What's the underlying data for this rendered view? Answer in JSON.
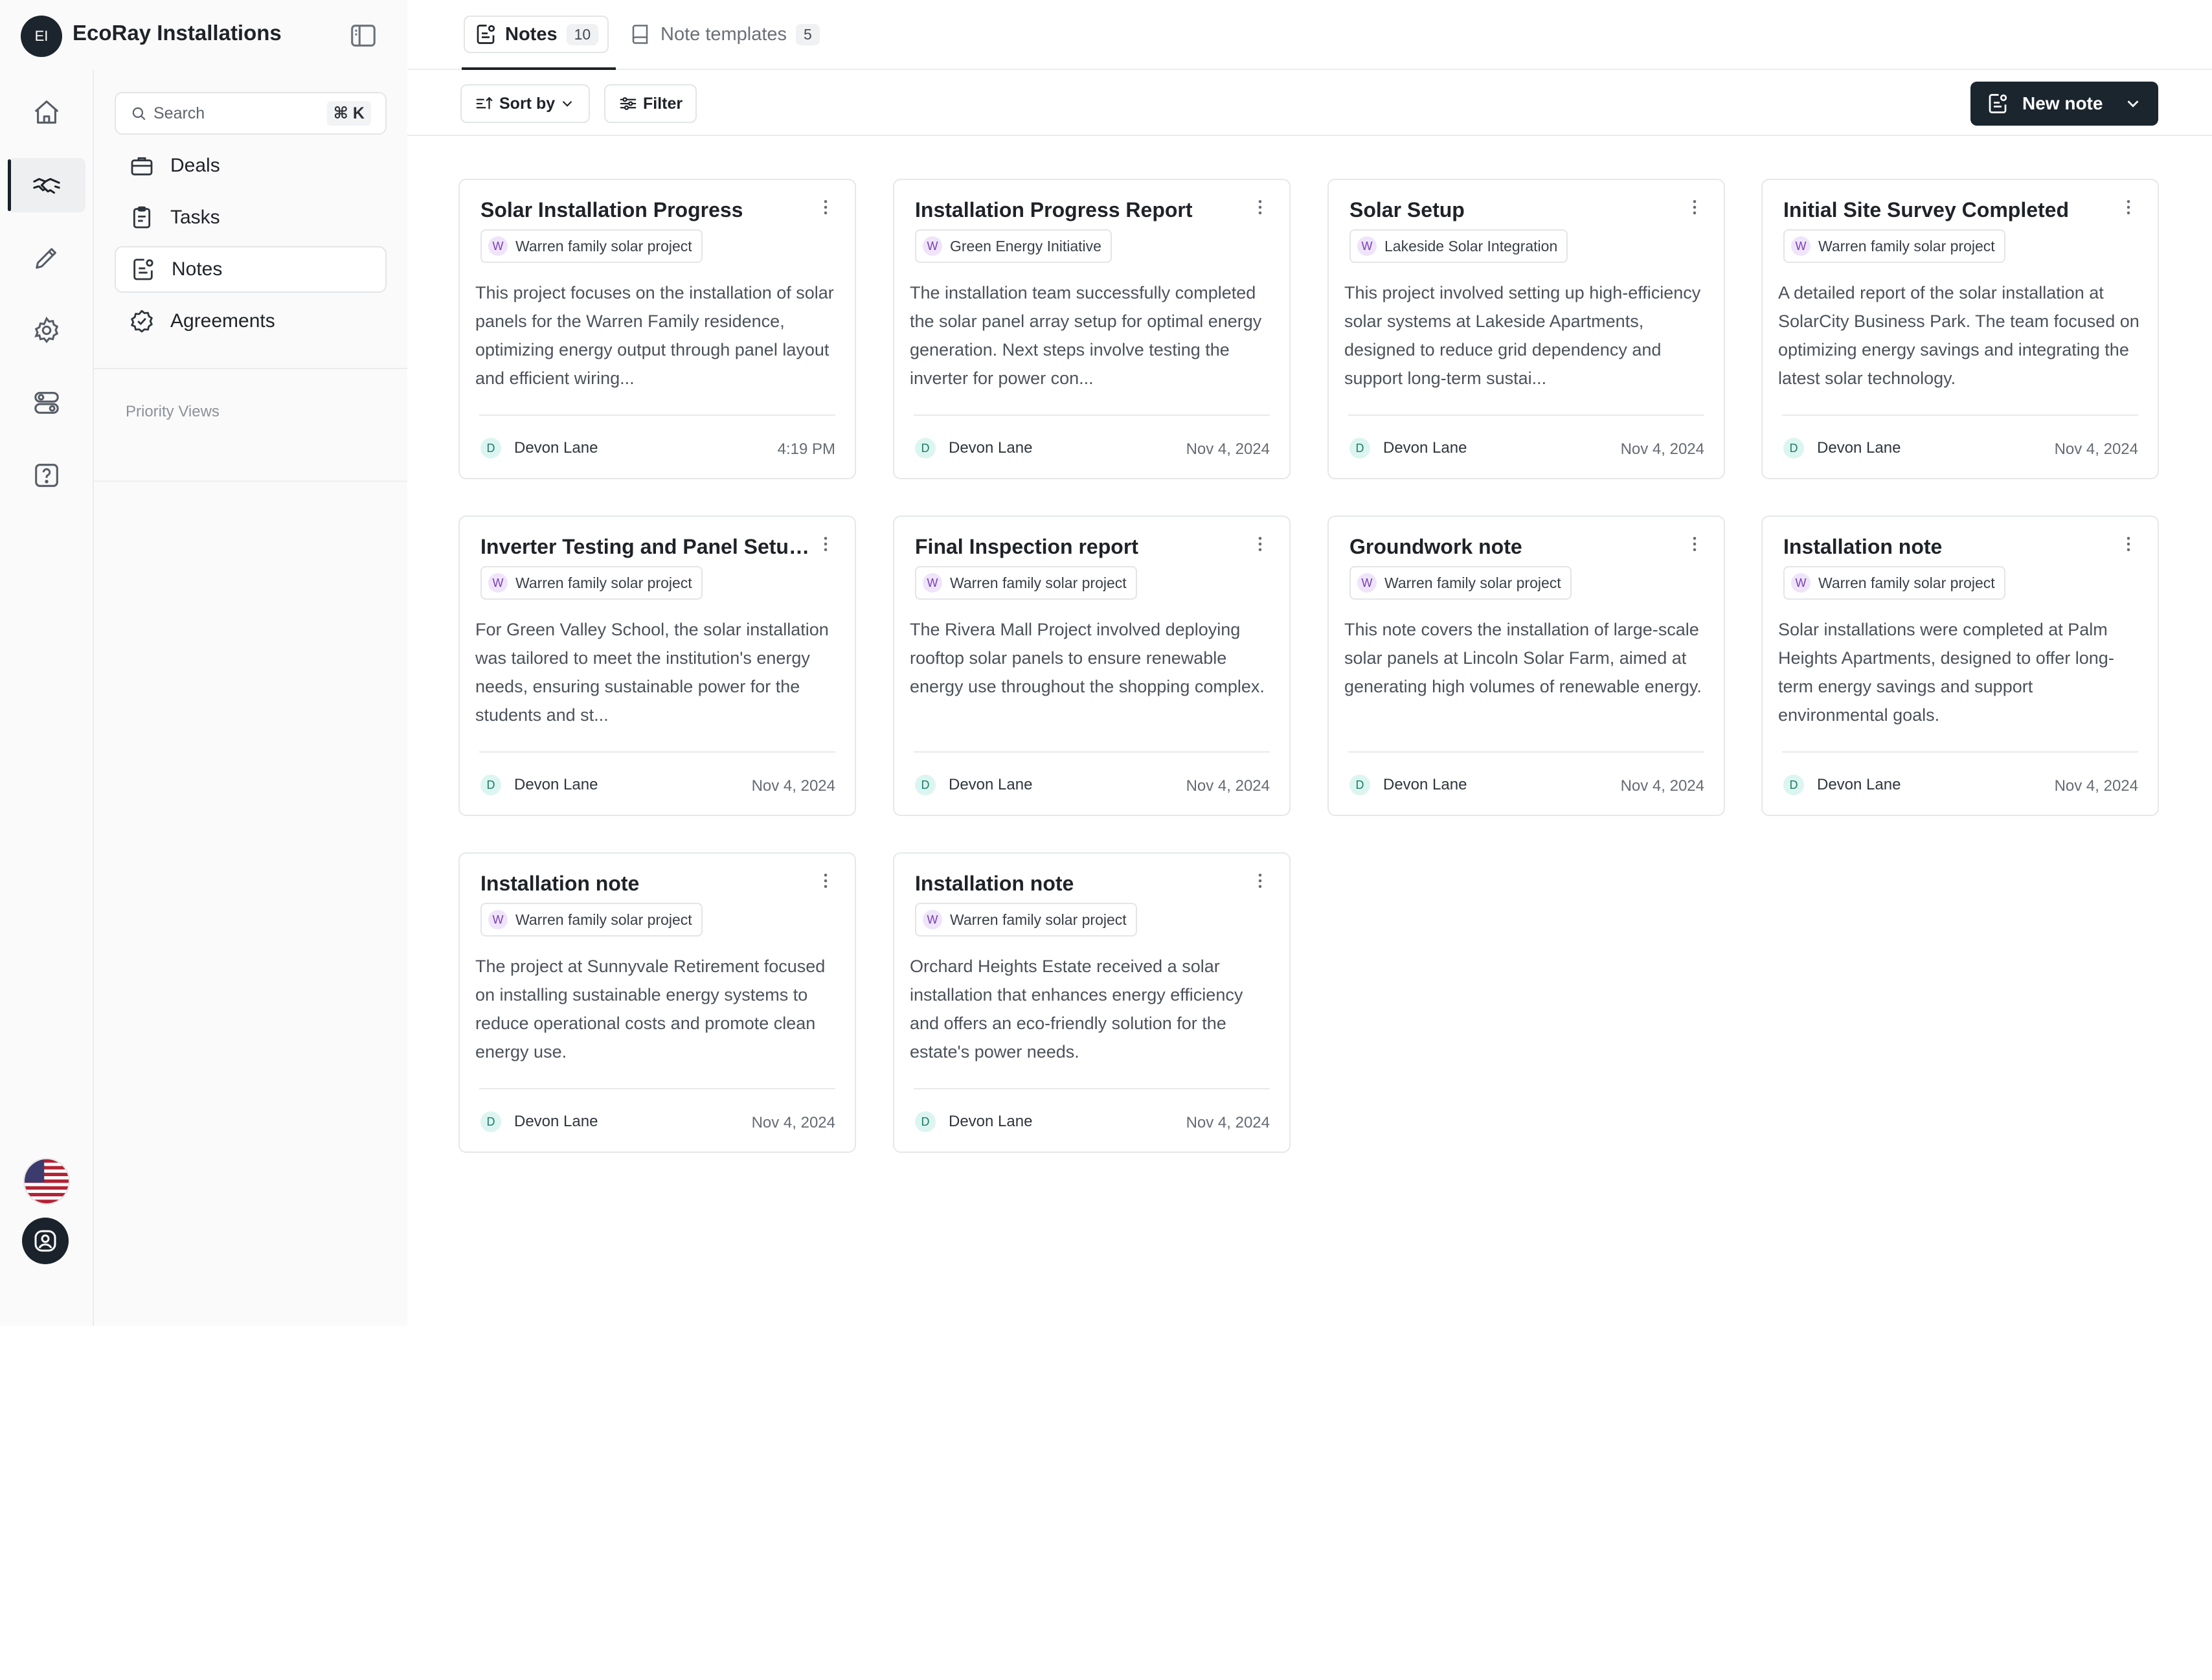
{
  "org": {
    "initials": "EI",
    "name": "EcoRay Installations"
  },
  "search": {
    "placeholder": "Search",
    "shortcut": "⌘ K"
  },
  "sidebar": {
    "items": [
      {
        "label": "Deals",
        "icon": "briefcase-icon"
      },
      {
        "label": "Tasks",
        "icon": "clipboard-icon"
      },
      {
        "label": "Notes",
        "icon": "note-icon",
        "active": true
      },
      {
        "label": "Agreements",
        "icon": "badge-check-icon"
      }
    ],
    "section_label": "Priority Views"
  },
  "rail": {
    "items": [
      "home-icon",
      "handshake-icon",
      "pencil-icon",
      "gear-icon",
      "toggles-icon",
      "help-icon"
    ],
    "active_index": 1
  },
  "tabs": [
    {
      "label": "Notes",
      "count": "10",
      "active": true
    },
    {
      "label": "Note templates",
      "count": "5",
      "active": false
    }
  ],
  "toolbar": {
    "sort_label": "Sort by",
    "filter_label": "Filter",
    "new_note_label": "New note"
  },
  "colors": {
    "primary_button": "#1b252e",
    "tag_avatar": "#efe4f9",
    "author_avatar": "#dcf5f0"
  },
  "notes": [
    {
      "title": "Solar Installation Progress",
      "project": "Warren family solar project",
      "project_initial": "W",
      "body": "This project focuses on the installation of solar panels for the Warren Family residence, optimizing energy output through panel layout and efficient wiring...",
      "author": "Devon Lane",
      "author_initial": "D",
      "date": "4:19 PM"
    },
    {
      "title": "Installation Progress Report",
      "project": "Green Energy Initiative",
      "project_initial": "W",
      "body": "The installation team successfully completed the solar panel array setup for optimal energy generation. Next steps involve testing the inverter for power con...",
      "author": "Devon Lane",
      "author_initial": "D",
      "date": "Nov 4, 2024"
    },
    {
      "title": "Solar Setup",
      "project": "Lakeside Solar Integration",
      "project_initial": "W",
      "body": "This project involved setting up high-efficiency solar systems at Lakeside Apartments, designed to reduce grid dependency and support long-term sustai...",
      "author": "Devon Lane",
      "author_initial": "D",
      "date": "Nov 4, 2024"
    },
    {
      "title": "Initial Site Survey Completed",
      "project": "Warren family solar project",
      "project_initial": "W",
      "body": "A detailed report of the solar installation at SolarCity Business Park. The team focused on optimizing energy savings and integrating the latest solar technology.",
      "author": "Devon Lane",
      "author_initial": "D",
      "date": "Nov 4, 2024"
    },
    {
      "title": "Inverter Testing and Panel Setup...",
      "project": "Warren family solar project",
      "project_initial": "W",
      "body": "For Green Valley School, the solar installation was tailored to meet the institution's energy needs, ensuring sustainable power for the students and st...",
      "author": "Devon Lane",
      "author_initial": "D",
      "date": "Nov 4, 2024"
    },
    {
      "title": "Final Inspection report",
      "project": "Warren family solar project",
      "project_initial": "W",
      "body": "The Rivera Mall Project involved deploying rooftop solar panels to ensure renewable energy use throughout the shopping complex.",
      "author": "Devon Lane",
      "author_initial": "D",
      "date": "Nov 4, 2024"
    },
    {
      "title": "Groundwork note",
      "project": "Warren family solar project",
      "project_initial": "W",
      "body": "This note covers the installation of large-scale solar panels at Lincoln Solar Farm, aimed at generating high volumes of renewable energy.",
      "author": "Devon Lane",
      "author_initial": "D",
      "date": "Nov 4, 2024"
    },
    {
      "title": "Installation note",
      "project": "Warren family solar project",
      "project_initial": "W",
      "body": "Solar installations were completed at Palm Heights Apartments, designed to offer long-term energy savings and support environmental goals.",
      "author": "Devon Lane",
      "author_initial": "D",
      "date": "Nov 4, 2024"
    },
    {
      "title": "Installation note",
      "project": "Warren family solar project",
      "project_initial": "W",
      "body": "The project at Sunnyvale Retirement focused on installing sustainable energy systems to reduce operational costs and promote clean energy use.",
      "author": "Devon Lane",
      "author_initial": "D",
      "date": "Nov 4, 2024"
    },
    {
      "title": "Installation note",
      "project": "Warren family solar project",
      "project_initial": "W",
      "body": "Orchard Heights Estate received a solar installation that enhances energy efficiency and offers an eco-friendly solution for the estate's power needs.",
      "author": "Devon Lane",
      "author_initial": "D",
      "date": "Nov 4, 2024"
    }
  ]
}
